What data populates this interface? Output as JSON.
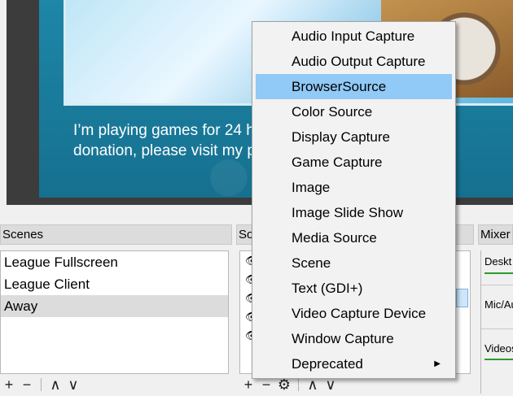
{
  "preview": {
    "line1": "I’m playing games for 24 hours to raise money for",
    "line2": "donation, please visit my page and click “DONATE”"
  },
  "docks": {
    "scenes_title": "Scenes",
    "sources_title": "So",
    "mixer_title": "Mixer"
  },
  "scenes": {
    "items": [
      {
        "label": "League Fullscreen"
      },
      {
        "label": "League Client"
      },
      {
        "label": "Away"
      }
    ],
    "toolbar": {
      "add": "+",
      "remove": "−",
      "up": "∧",
      "down": "∨"
    }
  },
  "sources": {
    "toolbar": {
      "add": "+",
      "remove": "−",
      "settings": "⚙",
      "up": "∧",
      "down": "∨"
    }
  },
  "mixer": {
    "channels": [
      {
        "label": "Deskt"
      },
      {
        "label": "Mic/Au"
      },
      {
        "label": "Videos"
      }
    ]
  },
  "context_menu": {
    "items": [
      {
        "label": "Audio Input Capture"
      },
      {
        "label": "Audio Output Capture"
      },
      {
        "label": "BrowserSource"
      },
      {
        "label": "Color Source"
      },
      {
        "label": "Display Capture"
      },
      {
        "label": "Game Capture"
      },
      {
        "label": "Image"
      },
      {
        "label": "Image Slide Show"
      },
      {
        "label": "Media Source"
      },
      {
        "label": "Scene"
      },
      {
        "label": "Text (GDI+)"
      },
      {
        "label": "Video Capture Device"
      },
      {
        "label": "Window Capture"
      },
      {
        "label": "Deprecated"
      }
    ],
    "hover_color": "#91c9f7"
  }
}
